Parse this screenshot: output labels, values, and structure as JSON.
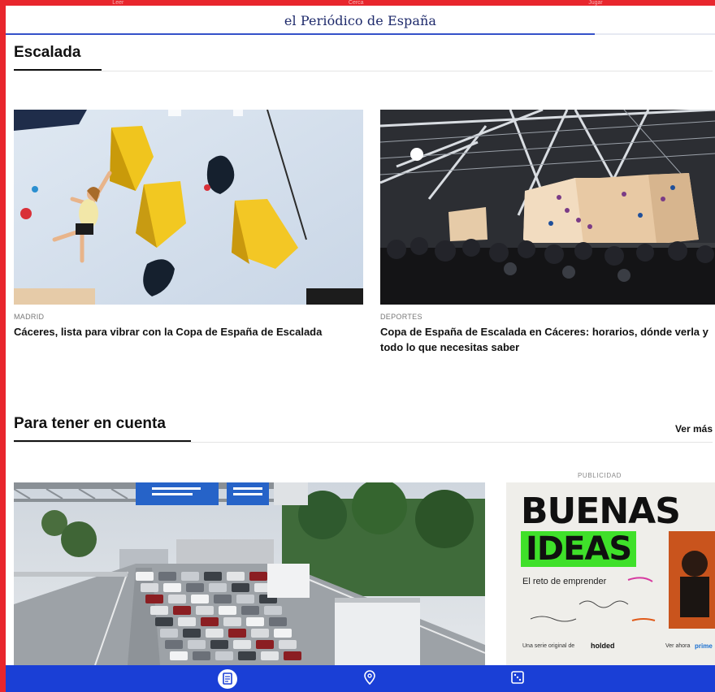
{
  "top_tabs": [
    "Leer",
    "Cerca",
    "Jugar"
  ],
  "masthead": {
    "title": "el Periódico de España"
  },
  "reading_progress": 0.83,
  "sections": [
    {
      "title": "Escalada",
      "cards": [
        {
          "section": "MADRID",
          "headline": "Cáceres, lista para vibrar con la Copa de España de Escalada",
          "image": "climber-on-yellow-holds-photo"
        },
        {
          "section": "DEPORTES",
          "headline": "Copa de España de Escalada en Cáceres: horarios, dónde verla y todo lo que necesitas saber",
          "image": "climbing-arena-crowd-photo"
        }
      ]
    },
    {
      "title": "Para tener en cuenta",
      "see_more": "Ver más",
      "cards": [
        {
          "image": "highway-traffic-photo"
        }
      ],
      "ad": {
        "label": "PUBLICIDAD",
        "line1": "BUENAS",
        "line2": "IDEAS",
        "subtitle": "El reto de emprender",
        "footer_left": "Una serie original de",
        "brand": "holded",
        "footer_right": "Ver ahora",
        "partner": "prime"
      }
    }
  ],
  "tabbar": [
    {
      "icon": "document-icon",
      "active": true
    },
    {
      "icon": "location-pin-icon",
      "active": false
    },
    {
      "icon": "dice-icon",
      "active": false
    }
  ],
  "colors": {
    "frame": "#e8262d",
    "tabbar": "#1a3fd6",
    "masthead": "#1e2a6b",
    "progress": "#3451c9",
    "ad_green": "#3fe02a"
  }
}
